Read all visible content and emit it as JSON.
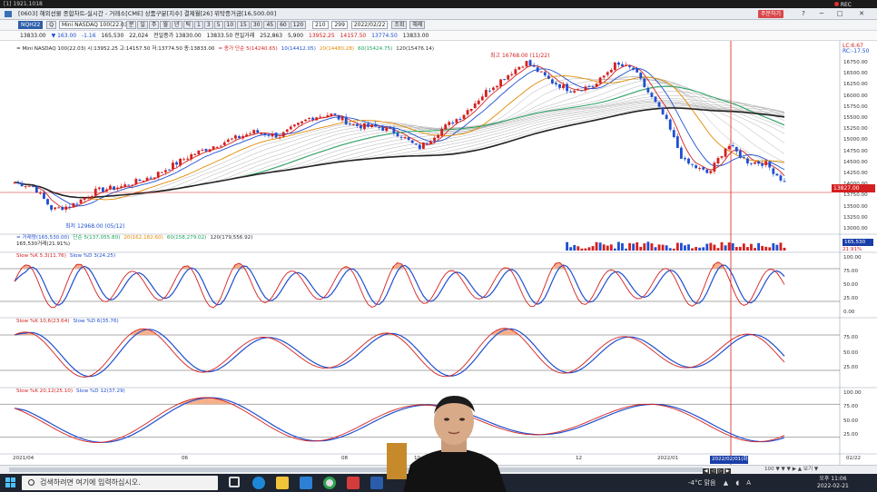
{
  "os_bar": {
    "app": "[1] 1921.1018",
    "rec": "REC"
  },
  "title_bar": {
    "title": "[0603] 해외선물 종합차트-실시간 - 거래소[CME] 상품구분[지수] 결제월[26] 위탁증거금[16,500.00]",
    "buy_button": "주문하기",
    "controls": [
      "?",
      "─",
      "□",
      "✕"
    ]
  },
  "toolbar1": {
    "code": "NQH22",
    "name": "Mini NASDAQ 100(22.03)",
    "search_btn": "Q",
    "period_buttons": [
      "분",
      "일",
      "주",
      "월",
      "년",
      "틱",
      "1",
      "3",
      "5",
      "10",
      "15",
      "30",
      "45",
      "60",
      "120"
    ],
    "count": "210",
    "total": "299",
    "date": "2022/02/22",
    "extra_buttons": [
      "조회",
      "해제"
    ]
  },
  "info_line": {
    "price": "13833.00",
    "change": "▼ 163.00",
    "rate": "-1.16",
    "volume": "165,530",
    "vol_change": "22,024",
    "prev_label": "전일종가 13830.00",
    "high_label": "13833.50 전일거래",
    "open": "252,863",
    "chg2": "5,900",
    "ohlc_o": "13952.25",
    "ohlc_h": "14157.50",
    "ohlc_l": "13774.50",
    "ohlc_c": "13833.00"
  },
  "main_legend": [
    {
      "text": "= Mini NASDAQ 100(22.03) 시:13952.25 고:14157.50 저:13774.50 종:13833.00",
      "color": "#222222"
    },
    {
      "text": "= 종가 단순 5(14240.65)",
      "color": "#d42020"
    },
    {
      "text": "10(14412.05)",
      "color": "#1f4fd0"
    },
    {
      "text": "20(14480.28)",
      "color": "#e08a00"
    },
    {
      "text": "60(15424.75)",
      "color": "#19a35a"
    },
    {
      "text": "120(15476.14)",
      "color": "#333333"
    }
  ],
  "annotations": {
    "high": "최고 16768.00 (11/22)",
    "low": "최저 12968.00 (05/12)",
    "current_price": "13827.00"
  },
  "price_axis": {
    "top_labels": [
      "LC:6.67",
      "RC:-17.50"
    ],
    "ticks": [
      "16750.00",
      "16500.00",
      "16250.00",
      "16000.00",
      "15750.00",
      "15500.00",
      "15250.00",
      "15000.00",
      "14750.00",
      "14500.00",
      "14250.00",
      "14000.00",
      "13750.00",
      "13500.00",
      "13250.00",
      "13000.00"
    ]
  },
  "volume_legend": [
    {
      "text": "= 거래량(165,530.00)",
      "color": "#1f4fd0"
    },
    {
      "text": "단순 5(137,055.80)",
      "color": "#19a35a"
    },
    {
      "text": "20(162,182.60)",
      "color": "#e08a00"
    },
    {
      "text": "60(158,279.02)",
      "color": "#19a35a"
    },
    {
      "text": "120(179,556.92)",
      "color": "#333333"
    },
    {
      "text": "165,530거래(21.91%)",
      "color": "#222222"
    }
  ],
  "volume_axis": {
    "value": "165,530",
    "label": "21.91%"
  },
  "stochastics": [
    {
      "k_label": "Slow %K 5,3(11.76)",
      "d_label": "Slow %D 3(24.25)",
      "ticks": [
        "100.00",
        "75.00",
        "50.00",
        "25.00",
        "0.00"
      ]
    },
    {
      "k_label": "Slow %K 10,6(23.64)",
      "d_label": "Slow %D 6(35.76)",
      "ticks": [
        "75.00",
        "50.00",
        "25.00"
      ]
    },
    {
      "k_label": "Slow %K 20,12(25.10)",
      "d_label": "Slow %D 12(37.29)",
      "ticks": [
        "100.00",
        "75.00",
        "50.00",
        "25.00"
      ]
    }
  ],
  "x_axis": {
    "labels": [
      "2021/04",
      "06",
      "08",
      "10",
      "12",
      "2022/01"
    ],
    "cursor_date": "2022/02/01(화)",
    "right_date": "02/22"
  },
  "scroll": {
    "text": "100 ▼ ▼ ▼ ▶ ▲ 보기 ▼"
  },
  "taskbar": {
    "search_placeholder": "검색하려면 여기에 입력하십시오.",
    "weather": "-4°C 맑음",
    "lang": "A",
    "time_top": "오후 11:06",
    "time_bottom": "2022-02-21"
  },
  "colors": {
    "up": "#d42020",
    "down": "#1f4fd0",
    "ma5": "#d42020",
    "ma10": "#1f4fd0",
    "ma20": "#e08a00",
    "ma60": "#19a35a",
    "cursor": "#d42020",
    "stoch_fill": "#f4a67c"
  },
  "icons": [
    "start-icon",
    "search-icon",
    "task-view-icon",
    "edge-icon",
    "file-explorer-icon",
    "store-icon",
    "chrome-icon",
    "app-icon",
    "hts-icon",
    "network-icon",
    "volume-icon"
  ]
}
